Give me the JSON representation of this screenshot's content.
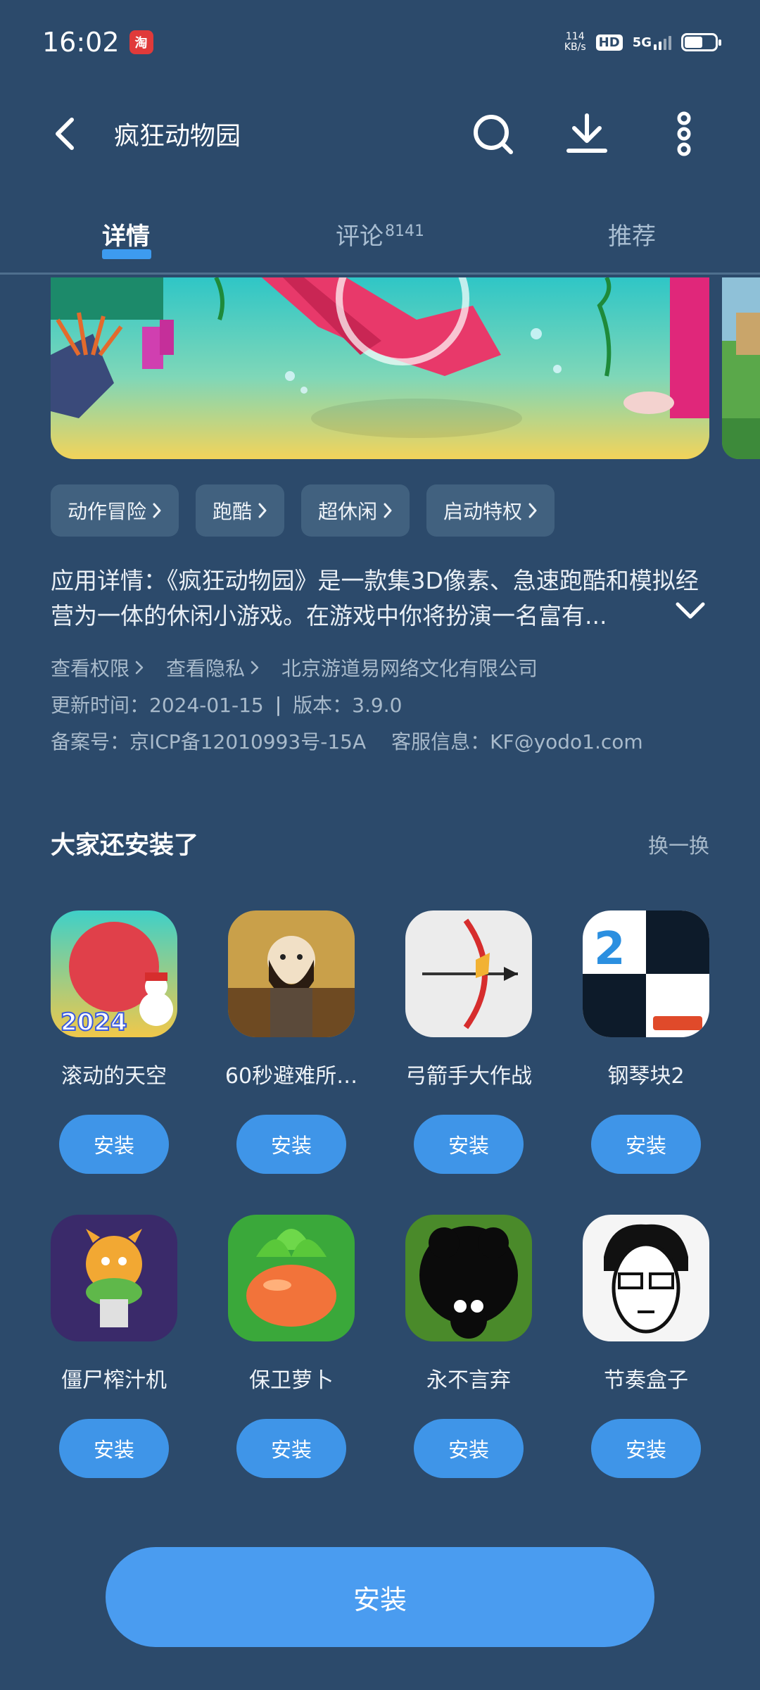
{
  "status_bar": {
    "time": "16:02",
    "net_speed_value": "114",
    "net_speed_unit": "KB/s",
    "hd_label": "HD",
    "network_label": "5G",
    "battery_level": 0.6
  },
  "header": {
    "title": "疯狂动物园"
  },
  "tabs": [
    {
      "label": "详情",
      "active": true
    },
    {
      "label": "评论",
      "count": "8141",
      "active": false
    },
    {
      "label": "推荐",
      "active": false
    }
  ],
  "tags": [
    "动作冒险",
    "跑酷",
    "超休闲",
    "启动特权"
  ],
  "description": "应用详情：《疯狂动物园》是一款集3D像素、急速跑酷和模拟经营为一体的休闲小游戏。在游戏中你将扮演一名富有...",
  "meta": {
    "permissions_link": "查看权限",
    "privacy_link": "查看隐私",
    "developer": "北京游道易网络文化有限公司",
    "update_time": "更新时间：2024-01-15",
    "separator": "|",
    "version": "版本：3.9.0",
    "icp": "备案号：京ICP备12010993号-15A",
    "support": "客服信息：KF@yodo1.com"
  },
  "recommend": {
    "title": "大家还安装了",
    "refresh_label": "换一换",
    "apps": [
      {
        "name": "滚动的天空",
        "install_label": "安装",
        "icon": "rolling-sky-icon"
      },
      {
        "name": "60秒避难所…",
        "install_label": "安装",
        "icon": "60-seconds-icon"
      },
      {
        "name": "弓箭手大作战",
        "install_label": "安装",
        "icon": "archer-icon"
      },
      {
        "name": "钢琴块2",
        "install_label": "安装",
        "icon": "piano-tiles-icon"
      },
      {
        "name": "僵尸榨汁机",
        "install_label": "安装",
        "icon": "zombie-juicer-icon"
      },
      {
        "name": "保卫萝卜",
        "install_label": "安装",
        "icon": "carrot-defense-icon"
      },
      {
        "name": "永不言弃",
        "install_label": "安装",
        "icon": "never-give-up-icon"
      },
      {
        "name": "节奏盒子",
        "install_label": "安装",
        "icon": "incredibox-icon"
      }
    ]
  },
  "main_install_label": "安装",
  "colors": {
    "background": "#2c4a6b",
    "accent": "#3d9bf0",
    "tag_bg": "#41617f",
    "muted_text": "#a8bacb"
  }
}
